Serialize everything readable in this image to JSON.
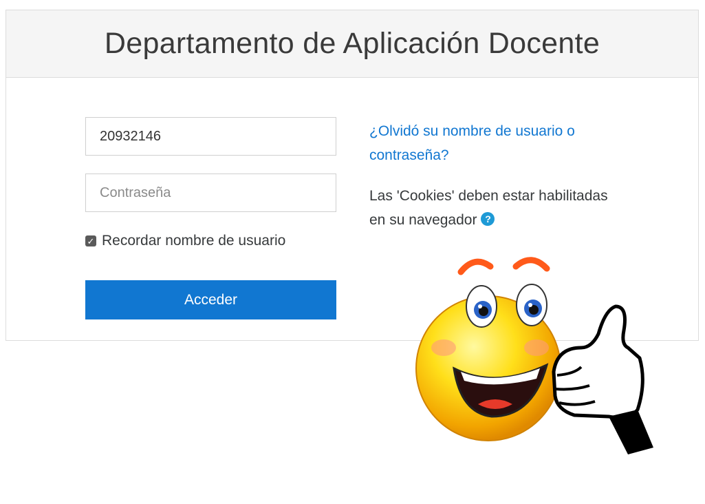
{
  "header": {
    "title": "Departamento de Aplicación Docente"
  },
  "login": {
    "username_value": "20932146",
    "password_placeholder": "Contraseña",
    "remember_label": "Recordar nombre de usuario",
    "remember_checked": true,
    "submit_label": "Acceder"
  },
  "aside": {
    "forgot_link": "¿Olvidó su nombre de usuario o contraseña?",
    "cookies_text": "Las 'Cookies' deben estar habilitadas en su navegador",
    "help_icon": "question-circle-icon"
  },
  "decoration": {
    "image": "thumbs-up-smiley"
  },
  "colors": {
    "accent": "#1177d1",
    "help": "#1e9ad6",
    "header_bg": "#f5f5f5"
  }
}
